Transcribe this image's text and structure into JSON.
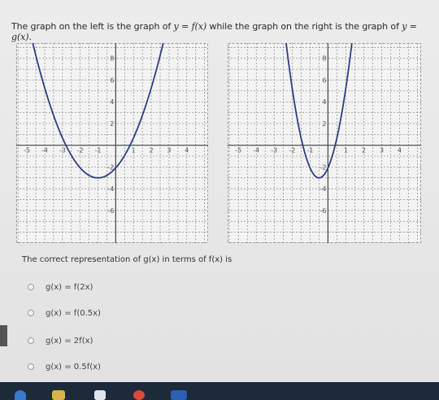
{
  "question": {
    "before": "The graph on the left is the graph of ",
    "f_expr": "y = f(x)",
    "middle": " while the graph on the right is the graph of ",
    "g_expr": "y = g(x)."
  },
  "graphs": {
    "x_ticks": [
      "-5",
      "-4",
      "-3",
      "-2",
      "-1",
      "1",
      "2",
      "3",
      "4"
    ],
    "y_ticks": [
      "8",
      "6",
      "4",
      "2",
      "-2",
      "-4",
      "-6"
    ]
  },
  "prompt": "The correct representation of g(x) in terms of f(x) is",
  "choices": [
    {
      "label": "g(x) = f(2x)"
    },
    {
      "label": "g(x) = f(0.5x)"
    },
    {
      "label": "g(x) = 2f(x)"
    },
    {
      "label": "g(x) = 0.5f(x)"
    }
  ],
  "colors": {
    "curve": "#2c3f86",
    "grid": "#8a8a8a",
    "axis": "#444444"
  },
  "taskbar_icons": [
    "start-icon",
    "file-explorer-icon",
    "store-icon",
    "chrome-icon",
    "word-icon"
  ]
}
